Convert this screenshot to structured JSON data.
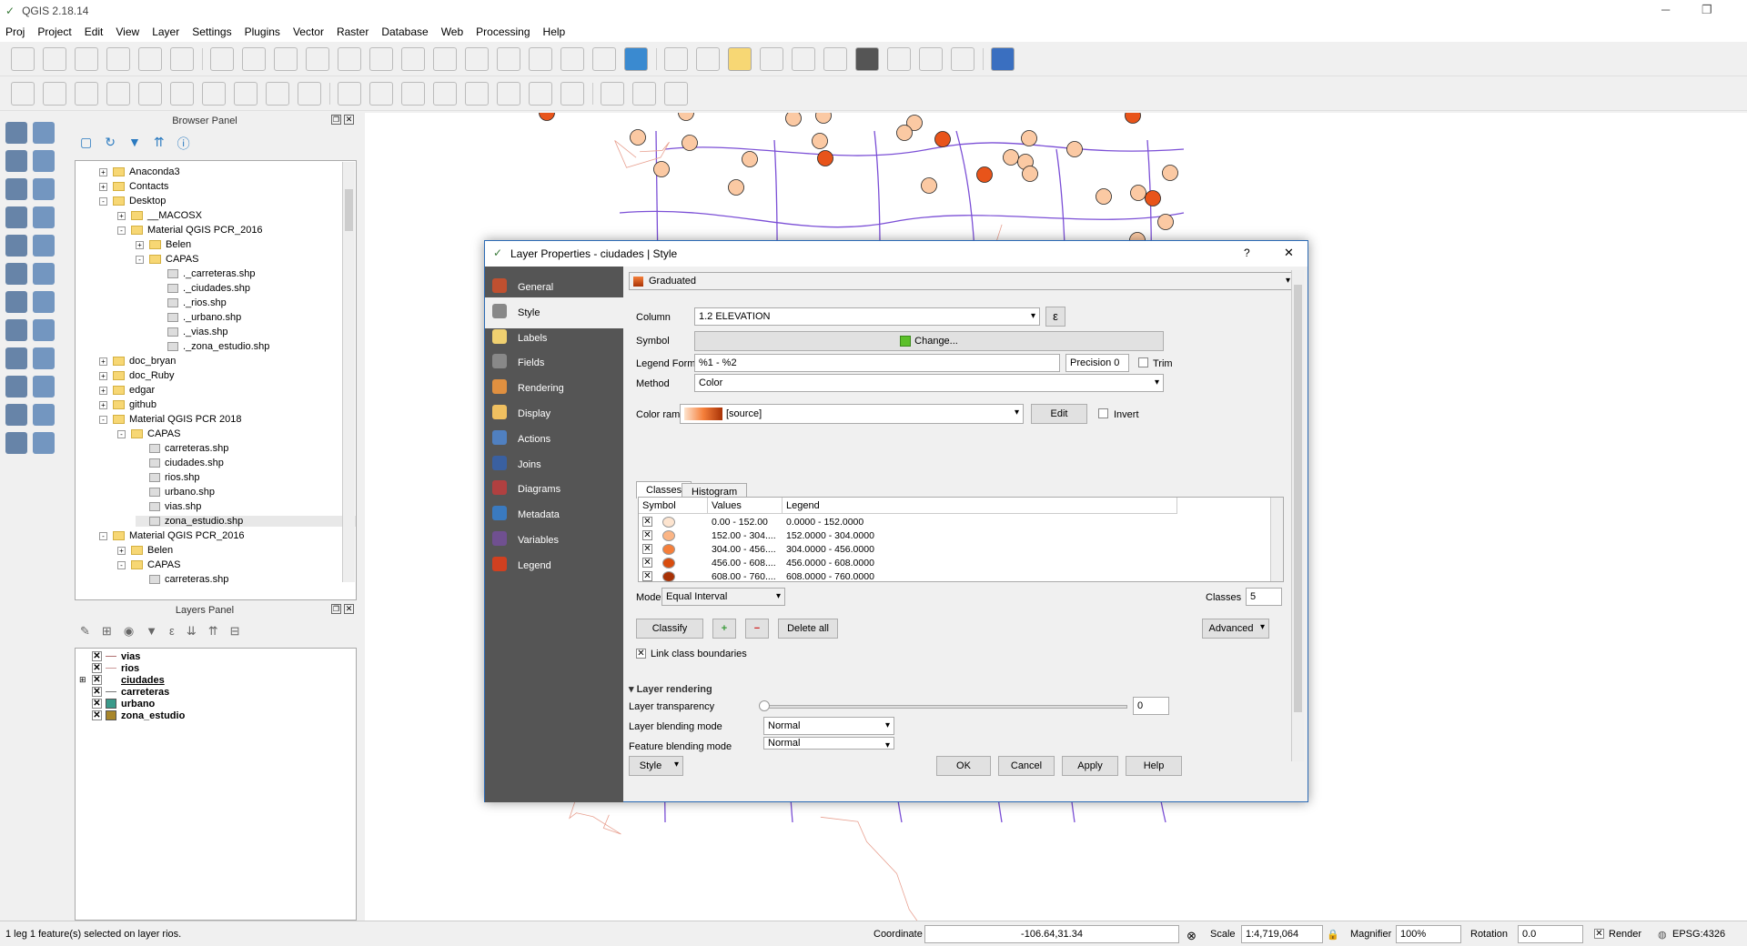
{
  "app": {
    "title": "QGIS 2.18.14"
  },
  "menu": [
    "Proj",
    "Project",
    "Edit",
    "View",
    "Layer",
    "Settings",
    "Plugins",
    "Vector",
    "Raster",
    "Database",
    "Web",
    "Processing",
    "Help"
  ],
  "browser": {
    "title": "Browser Panel",
    "items": [
      {
        "label": "Anaconda3",
        "depth": 0,
        "exp": "+",
        "kind": "folder"
      },
      {
        "label": "Contacts",
        "depth": 0,
        "exp": "+",
        "kind": "folder"
      },
      {
        "label": "Desktop",
        "depth": 0,
        "exp": "-",
        "kind": "folder"
      },
      {
        "label": "__MACOSX",
        "depth": 1,
        "exp": "+",
        "kind": "folder"
      },
      {
        "label": "Material QGIS PCR_2016",
        "depth": 1,
        "exp": "-",
        "kind": "folder"
      },
      {
        "label": "Belen",
        "depth": 2,
        "exp": "+",
        "kind": "folder"
      },
      {
        "label": "CAPAS",
        "depth": 2,
        "exp": "-",
        "kind": "folder"
      },
      {
        "label": "._carreteras.shp",
        "depth": 3,
        "exp": "",
        "kind": "file"
      },
      {
        "label": "._ciudades.shp",
        "depth": 3,
        "exp": "",
        "kind": "file"
      },
      {
        "label": "._rios.shp",
        "depth": 3,
        "exp": "",
        "kind": "file"
      },
      {
        "label": "._urbano.shp",
        "depth": 3,
        "exp": "",
        "kind": "file"
      },
      {
        "label": "._vias.shp",
        "depth": 3,
        "exp": "",
        "kind": "file"
      },
      {
        "label": "._zona_estudio.shp",
        "depth": 3,
        "exp": "",
        "kind": "file"
      },
      {
        "label": "doc_bryan",
        "depth": 0,
        "exp": "+",
        "kind": "folder"
      },
      {
        "label": "doc_Ruby",
        "depth": 0,
        "exp": "+",
        "kind": "folder"
      },
      {
        "label": "edgar",
        "depth": 0,
        "exp": "+",
        "kind": "folder"
      },
      {
        "label": "github",
        "depth": 0,
        "exp": "+",
        "kind": "folder"
      },
      {
        "label": "Material QGIS PCR 2018",
        "depth": 0,
        "exp": "-",
        "kind": "folder"
      },
      {
        "label": "CAPAS",
        "depth": 1,
        "exp": "-",
        "kind": "folder"
      },
      {
        "label": "carreteras.shp",
        "depth": 2,
        "exp": "",
        "kind": "file"
      },
      {
        "label": "ciudades.shp",
        "depth": 2,
        "exp": "",
        "kind": "file"
      },
      {
        "label": "rios.shp",
        "depth": 2,
        "exp": "",
        "kind": "file"
      },
      {
        "label": "urbano.shp",
        "depth": 2,
        "exp": "",
        "kind": "file"
      },
      {
        "label": "vias.shp",
        "depth": 2,
        "exp": "",
        "kind": "file"
      },
      {
        "label": "zona_estudio.shp",
        "depth": 2,
        "exp": "",
        "kind": "file"
      },
      {
        "label": "Material QGIS PCR_2016",
        "depth": 0,
        "exp": "-",
        "kind": "folder"
      },
      {
        "label": "Belen",
        "depth": 1,
        "exp": "+",
        "kind": "folder"
      },
      {
        "label": "CAPAS",
        "depth": 1,
        "exp": "-",
        "kind": "folder"
      },
      {
        "label": "carreteras.shp",
        "depth": 2,
        "exp": "",
        "kind": "file"
      }
    ]
  },
  "layers": {
    "title": "Layers Panel",
    "items": [
      {
        "label": "vias",
        "swatch": "#b07070",
        "line": true
      },
      {
        "label": "rios",
        "swatch": "#cc9999",
        "line": true
      },
      {
        "label": "ciudades",
        "swatch": "",
        "line": false
      },
      {
        "label": "carreteras",
        "swatch": "#777",
        "line": true
      },
      {
        "label": "urbano",
        "swatch": "#3a9a8a",
        "line": false
      },
      {
        "label": "zona_estudio",
        "swatch": "#a8862a",
        "line": false
      }
    ]
  },
  "dialog": {
    "title": "Layer Properties - ciudades | Style",
    "help": "?",
    "close": "✕",
    "sidebar": [
      "General",
      "Style",
      "Labels",
      "Fields",
      "Rendering",
      "Display",
      "Actions",
      "Joins",
      "Diagrams",
      "Metadata",
      "Variables",
      "Legend"
    ],
    "renderer": "Graduated",
    "column_label": "Column",
    "column_value": "1.2 ELEVATION",
    "symbol_label": "Symbol",
    "change_label": "Change...",
    "legend_format_label": "Legend Format",
    "legend_format_value": "%1 - %2",
    "precision_label": "Precision 0",
    "trim_label": "Trim",
    "method_label": "Method",
    "method_value": "Color",
    "color_ramp_label": "Color ramp",
    "color_ramp_value": "[source]",
    "edit_label": "Edit",
    "invert_label": "Invert",
    "tabs": [
      "Classes",
      "Histogram"
    ],
    "headers": [
      "Symbol",
      "Values",
      "Legend"
    ],
    "classes": [
      {
        "values": "0.00 - 152.00",
        "legend": "0.0000 - 152.0000",
        "color": "#fde4cf"
      },
      {
        "values": "152.00 - 304....",
        "legend": "152.0000 - 304.0000",
        "color": "#fbb585"
      },
      {
        "values": "304.00 - 456....",
        "legend": "304.0000 - 456.0000",
        "color": "#f57f3a"
      },
      {
        "values": "456.00 - 608....",
        "legend": "456.0000 - 608.0000",
        "color": "#d84d0f"
      },
      {
        "values": "608.00 - 760....",
        "legend": "608.0000 - 760.0000",
        "color": "#a83206"
      }
    ],
    "mode_label": "Mode",
    "mode_value": "Equal Interval",
    "classes_label": "Classes",
    "classes_value": "5",
    "classify_label": "Classify",
    "delete_all_label": "Delete all",
    "advanced_label": "Advanced",
    "link_label": "Link class boundaries",
    "layer_rendering_label": "Layer rendering",
    "transparency_label": "Layer transparency",
    "transparency_value": "0",
    "blending_label": "Layer blending mode",
    "blending_value": "Normal",
    "feature_blending_label": "Feature blending mode",
    "feature_blending_value": "Normal",
    "style_label": "Style",
    "ok_label": "OK",
    "cancel_label": "Cancel",
    "apply_label": "Apply",
    "help_label": "Help"
  },
  "status": {
    "message": "1 leg  1 feature(s) selected on layer rios.",
    "coordinate_label": "Coordinate",
    "coordinate_value": "-106.64,31.34",
    "scale_label": "Scale",
    "scale_value": "1:4,719,064",
    "magnifier_label": "Magnifier",
    "magnifier_value": "100%",
    "rotation_label": "Rotation",
    "rotation_value": "0.0",
    "render_label": "Render",
    "crs": "EPSG:4326"
  },
  "colors": {
    "accent": "#2d6bb5",
    "city_light": "#fbc9a3",
    "city_dark": "#e8541a",
    "vias": "#7b4fd6",
    "rios": "#e8a090"
  }
}
